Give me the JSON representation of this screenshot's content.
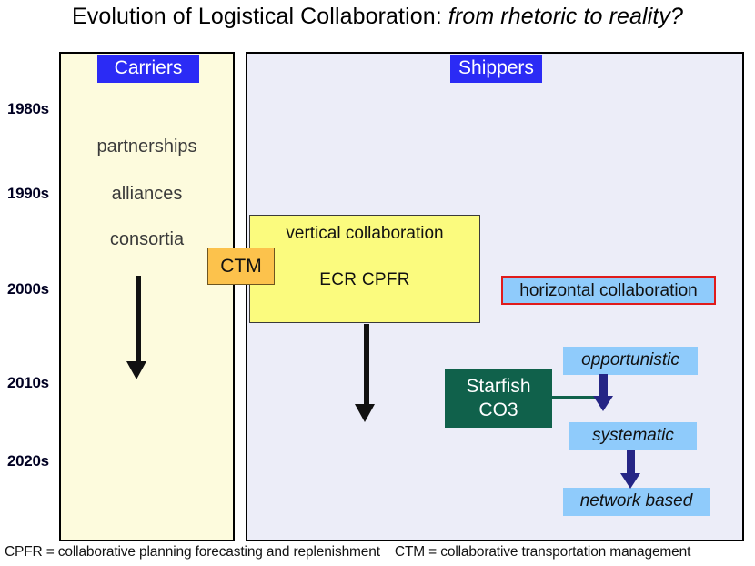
{
  "title": {
    "main": "Evolution of Logistical Collaboration: ",
    "emphasis": "from rhetoric to reality?"
  },
  "panels": {
    "carriers": {
      "label": "Carriers"
    },
    "shippers": {
      "label": "Shippers"
    }
  },
  "timeline": {
    "decades": [
      "1980s",
      "1990s",
      "2000s",
      "2010s",
      "2020s"
    ]
  },
  "carriers": {
    "terms": [
      "partnerships",
      "alliances",
      "consortia"
    ]
  },
  "shippers": {
    "ctm_label": "CTM",
    "vertical_collaboration": {
      "title": "vertical collaboration",
      "subtitle": "ECR   CPFR"
    },
    "horizontal_collaboration": {
      "label": "horizontal collaboration"
    },
    "starfish": {
      "line1": "Starfish",
      "line2": "CO3"
    },
    "maturity_stages": [
      "opportunistic",
      "systematic",
      "network based"
    ]
  },
  "footnote": {
    "cpfr": "CPFR = collaborative planning forecasting and replenishment",
    "ctm": "CTM = collaborative transportation management"
  },
  "colors": {
    "carriers_panel_fill": "#fdfbdd",
    "shippers_panel_fill": "#ecedf8",
    "header_chip": "#2b2bf5",
    "ctm_fill": "#fcc24c",
    "vertical_fill": "#fbfb7e",
    "blue_box_fill": "#8fcbfb",
    "horizontal_border": "#e01b1b",
    "starfish_fill": "#10614b",
    "navy_arrow": "#252585",
    "black_arrow": "#111111"
  }
}
